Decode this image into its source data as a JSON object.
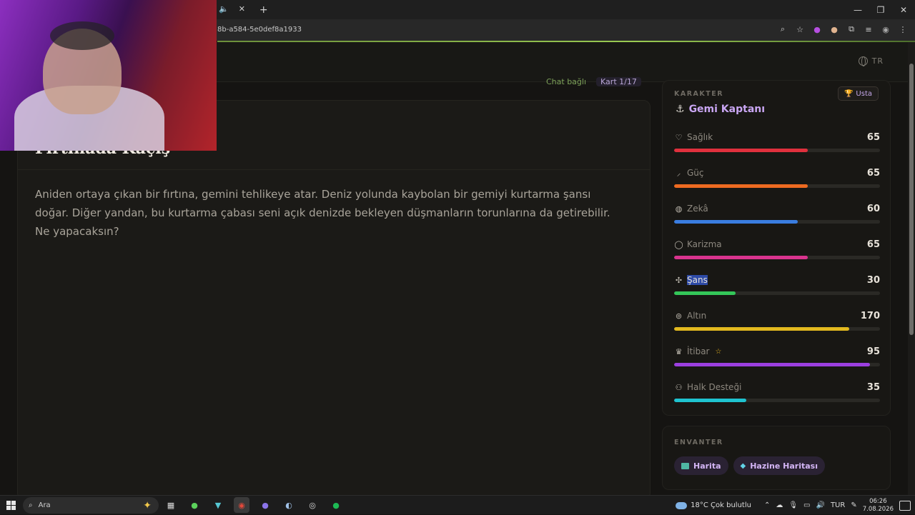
{
  "browser": {
    "url_fragment": "8b-a584-5e0def8a1933",
    "tab_icons": [
      "speaker-icon",
      "close-icon",
      "plus-icon"
    ]
  },
  "header": {
    "language": "TR"
  },
  "crumbs": {
    "chat": "Chat bağlı",
    "card": "Kart 1/17"
  },
  "story": {
    "title": "Fırtınada Kaçış",
    "text": "Aniden ortaya çıkan bir fırtına, gemini tehlikeye atar. Deniz yolunda kaybolan bir gemiyi kurtarma şansı doğar. Diğer yandan, bu kurtarma çabası seni açık denizde bekleyen düşmanların torunlarına da getirebilir. Ne yapacaksın?"
  },
  "character": {
    "label": "KARAKTER",
    "rank": "Usta",
    "name": "Gemi Kaptanı",
    "stats": [
      {
        "key": "saglik",
        "label": "Sağlık",
        "value": "65",
        "fill": 0.65,
        "color": "#e0303d",
        "icon": "heart-icon"
      },
      {
        "key": "guc",
        "label": "Güç",
        "value": "65",
        "fill": 0.65,
        "color": "#ee6a21",
        "icon": "sword-icon"
      },
      {
        "key": "zeka",
        "label": "Zekâ",
        "value": "60",
        "fill": 0.6,
        "color": "#3a7de0",
        "icon": "brain-icon"
      },
      {
        "key": "karizma",
        "label": "Karizma",
        "value": "65",
        "fill": 0.65,
        "color": "#d9348e",
        "icon": "speech-icon"
      },
      {
        "key": "sans",
        "label": "Şans",
        "value": "30",
        "fill": 0.3,
        "color": "#34c759",
        "icon": "clover-icon"
      },
      {
        "key": "altin",
        "label": "Altın",
        "value": "170",
        "fill": 0.85,
        "color": "#e2b91f",
        "icon": "coins-icon"
      },
      {
        "key": "itibar",
        "label": "İtibar",
        "value": "95",
        "fill": 0.95,
        "color": "#9b3fe0",
        "icon": "crown-icon"
      },
      {
        "key": "halk",
        "label": "Halk Desteği",
        "value": "35",
        "fill": 0.35,
        "color": "#1fc3d0",
        "icon": "people-icon"
      }
    ]
  },
  "inventory": {
    "label": "ENVANTER",
    "items": [
      {
        "label": "Harita",
        "icon": "map-icon"
      },
      {
        "label": "Hazine Haritası",
        "icon": "gem-icon"
      }
    ]
  },
  "taskbar": {
    "search_placeholder": "Ara",
    "weather": "18°C  Çok bulutlu",
    "lang": "TUR",
    "time": "06:26",
    "date": "7.08.2026"
  }
}
